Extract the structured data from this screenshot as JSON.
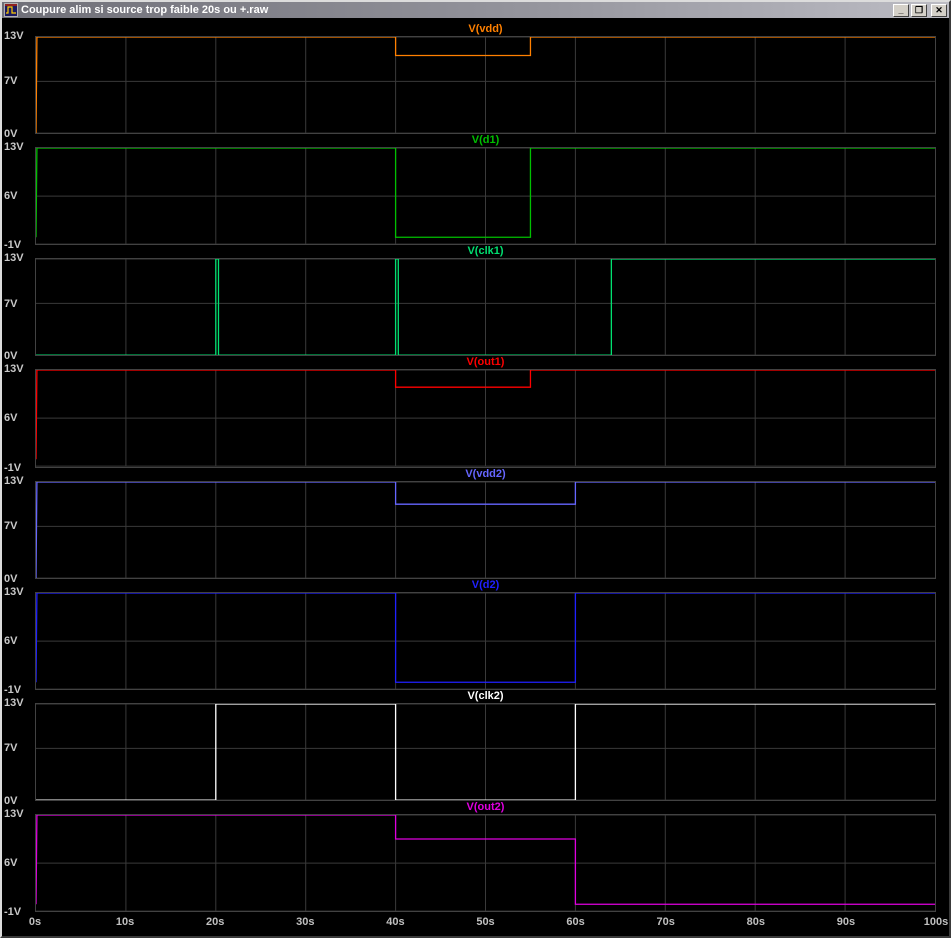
{
  "window": {
    "title": "Coupure alim si source trop faible 20s ou +.raw",
    "controls": {
      "minimize": "_",
      "maximize": "❐",
      "close": "✕"
    }
  },
  "axis": {
    "x_min": 0,
    "x_max": 100,
    "x_unit": "s",
    "x_ticks": [
      {
        "label": "0s",
        "value": 0
      },
      {
        "label": "10s",
        "value": 10
      },
      {
        "label": "20s",
        "value": 20
      },
      {
        "label": "30s",
        "value": 30
      },
      {
        "label": "40s",
        "value": 40
      },
      {
        "label": "50s",
        "value": 50
      },
      {
        "label": "60s",
        "value": 60
      },
      {
        "label": "70s",
        "value": 70
      },
      {
        "label": "80s",
        "value": 80
      },
      {
        "label": "90s",
        "value": 90
      },
      {
        "label": "100s",
        "value": 100
      }
    ]
  },
  "style": {
    "background": "#000000",
    "grid_color": "#3a3a3a",
    "axis_text_color": "#c8c8c8"
  },
  "chart_data": [
    {
      "type": "line",
      "name": "V(vdd)",
      "color": "#ff8000",
      "ymin": 0,
      "ymax": 13,
      "ylabels": [
        {
          "text": "13V",
          "value": 13
        },
        {
          "text": "7V",
          "value": 7
        },
        {
          "text": "0V",
          "value": 0
        }
      ],
      "points": [
        [
          0,
          0
        ],
        [
          0.1,
          13
        ],
        [
          40,
          13
        ],
        [
          40,
          10.5
        ],
        [
          55,
          10.5
        ],
        [
          55,
          13
        ],
        [
          100,
          13
        ]
      ]
    },
    {
      "type": "line",
      "name": "V(d1)",
      "color": "#00c000",
      "ymin": -1,
      "ymax": 13,
      "ylabels": [
        {
          "text": "13V",
          "value": 13
        },
        {
          "text": "6V",
          "value": 6
        },
        {
          "text": "-1V",
          "value": -1
        }
      ],
      "points": [
        [
          0,
          0
        ],
        [
          0.1,
          13
        ],
        [
          40,
          13
        ],
        [
          40,
          0
        ],
        [
          55,
          0
        ],
        [
          55,
          13
        ],
        [
          100,
          13
        ]
      ]
    },
    {
      "type": "line",
      "name": "V(clk1)",
      "color": "#00e070",
      "ymin": 0,
      "ymax": 13,
      "ylabels": [
        {
          "text": "13V",
          "value": 13
        },
        {
          "text": "7V",
          "value": 7
        },
        {
          "text": "0V",
          "value": 0
        }
      ],
      "points": [
        [
          0,
          0
        ],
        [
          20,
          0
        ],
        [
          20,
          13
        ],
        [
          20.3,
          13
        ],
        [
          20.3,
          0
        ],
        [
          40,
          0
        ],
        [
          40,
          13
        ],
        [
          40.3,
          13
        ],
        [
          40.3,
          0
        ],
        [
          64,
          0
        ],
        [
          64,
          13
        ],
        [
          100,
          13
        ]
      ]
    },
    {
      "type": "line",
      "name": "V(out1)",
      "color": "#ff0000",
      "ymin": -1,
      "ymax": 13,
      "ylabels": [
        {
          "text": "13V",
          "value": 13
        },
        {
          "text": "6V",
          "value": 6
        },
        {
          "text": "-1V",
          "value": -1
        }
      ],
      "points": [
        [
          0,
          0
        ],
        [
          0.1,
          13
        ],
        [
          40,
          13
        ],
        [
          40,
          10.5
        ],
        [
          55,
          10.5
        ],
        [
          55,
          13
        ],
        [
          100,
          13
        ]
      ]
    },
    {
      "type": "line",
      "name": "V(vdd2)",
      "color": "#6666ff",
      "ymin": 0,
      "ymax": 13,
      "ylabels": [
        {
          "text": "13V",
          "value": 13
        },
        {
          "text": "7V",
          "value": 7
        },
        {
          "text": "0V",
          "value": 0
        }
      ],
      "points": [
        [
          0,
          0
        ],
        [
          0.1,
          13
        ],
        [
          40,
          13
        ],
        [
          40,
          10
        ],
        [
          60,
          10
        ],
        [
          60,
          13
        ],
        [
          100,
          13
        ]
      ]
    },
    {
      "type": "line",
      "name": "V(d2)",
      "color": "#2020ff",
      "ymin": -1,
      "ymax": 13,
      "ylabels": [
        {
          "text": "13V",
          "value": 13
        },
        {
          "text": "6V",
          "value": 6
        },
        {
          "text": "-1V",
          "value": -1
        }
      ],
      "points": [
        [
          0,
          0
        ],
        [
          0.1,
          13
        ],
        [
          40,
          13
        ],
        [
          40,
          0
        ],
        [
          60,
          0
        ],
        [
          60,
          13
        ],
        [
          100,
          13
        ]
      ]
    },
    {
      "type": "line",
      "name": "V(clk2)",
      "color": "#ffffff",
      "ymin": 0,
      "ymax": 13,
      "ylabels": [
        {
          "text": "13V",
          "value": 13
        },
        {
          "text": "7V",
          "value": 7
        },
        {
          "text": "0V",
          "value": 0
        }
      ],
      "points": [
        [
          0,
          0
        ],
        [
          20,
          0
        ],
        [
          20,
          13
        ],
        [
          40,
          13
        ],
        [
          40,
          0
        ],
        [
          60,
          0
        ],
        [
          60,
          13
        ],
        [
          100,
          13
        ]
      ]
    },
    {
      "type": "line",
      "name": "V(out2)",
      "color": "#e000e0",
      "ymin": -1,
      "ymax": 13,
      "ylabels": [
        {
          "text": "13V",
          "value": 13
        },
        {
          "text": "6V",
          "value": 6
        },
        {
          "text": "-1V",
          "value": -1
        }
      ],
      "points": [
        [
          0,
          0
        ],
        [
          0.1,
          13
        ],
        [
          40,
          13
        ],
        [
          40,
          9.5
        ],
        [
          60,
          9.5
        ],
        [
          60,
          0
        ],
        [
          100,
          0
        ]
      ]
    }
  ]
}
